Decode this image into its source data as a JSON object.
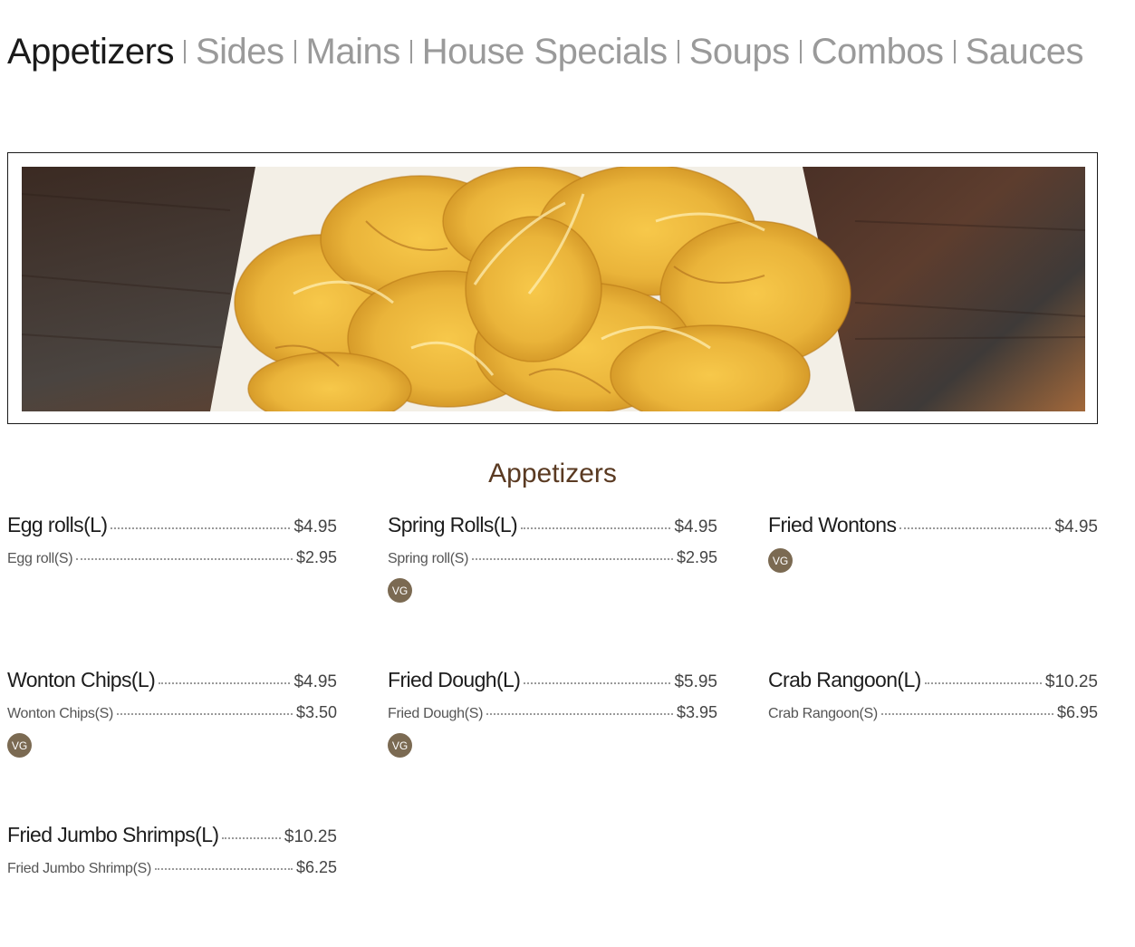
{
  "nav": {
    "tabs": [
      {
        "label": "Appetizers",
        "active": true
      },
      {
        "label": "Sides"
      },
      {
        "label": "Mains"
      },
      {
        "label": "House Specials"
      },
      {
        "label": "Soups"
      },
      {
        "label": "Combos"
      },
      {
        "label": "Sauces"
      }
    ]
  },
  "section_title": "Appetizers",
  "items": [
    {
      "name": "Egg rolls(L)",
      "price": "$4.95",
      "sub_name": "Egg roll(S)",
      "sub_price": "$2.95"
    },
    {
      "name": "Spring Rolls(L)",
      "price": "$4.95",
      "sub_name": "Spring roll(S)",
      "sub_price": "$2.95",
      "badge": "VG"
    },
    {
      "name": "Fried Wontons",
      "price": "$4.95",
      "badge": "VG"
    },
    {
      "name": "Wonton Chips(L)",
      "price": "$4.95",
      "sub_name": "Wonton Chips(S)",
      "sub_price": "$3.50",
      "badge": "VG"
    },
    {
      "name": "Fried Dough(L)",
      "price": "$5.95",
      "sub_name": "Fried Dough(S)",
      "sub_price": "$3.95",
      "badge": "VG"
    },
    {
      "name": "Crab Rangoon(L)",
      "price": "$10.25",
      "sub_name": "Crab Rangoon(S)",
      "sub_price": "$6.95"
    },
    {
      "name": "Fried Jumbo Shrimps(L)",
      "price": "$10.25",
      "sub_name": "Fried Jumbo Shrimp(S)",
      "sub_price": "$6.25"
    }
  ],
  "colors": {
    "title_brown": "#5a3a22",
    "badge_brown": "#7b6a52",
    "inactive_tab": "#9a9a9a"
  }
}
